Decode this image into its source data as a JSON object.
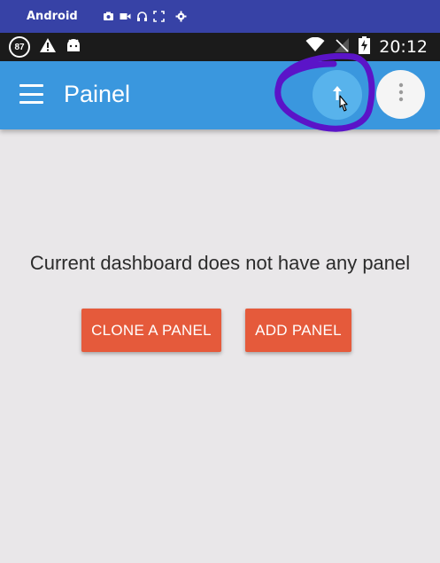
{
  "emulator": {
    "title": "Android",
    "icons": [
      "camera-icon",
      "video-icon",
      "headset-icon",
      "fullscreen-icon",
      "settings-icon"
    ]
  },
  "status_bar": {
    "badge": "87",
    "time": "20:12",
    "icons": [
      "warning-icon",
      "android-icon",
      "wifi-icon",
      "no-signal-icon",
      "battery-charging-icon"
    ]
  },
  "app_bar": {
    "title": "Painel",
    "color": "#3a97de",
    "menu_icon": "hamburger-menu-icon",
    "upload_icon": "arrow-up-icon",
    "overflow_icon": "more-vert-icon"
  },
  "content": {
    "empty_message": "Current dashboard does not have any panel",
    "clone_label": "CLONE A PANEL",
    "add_label": "ADD PANEL",
    "button_color": "#e55a3b"
  },
  "annotation": {
    "color": "#5b14c8"
  }
}
